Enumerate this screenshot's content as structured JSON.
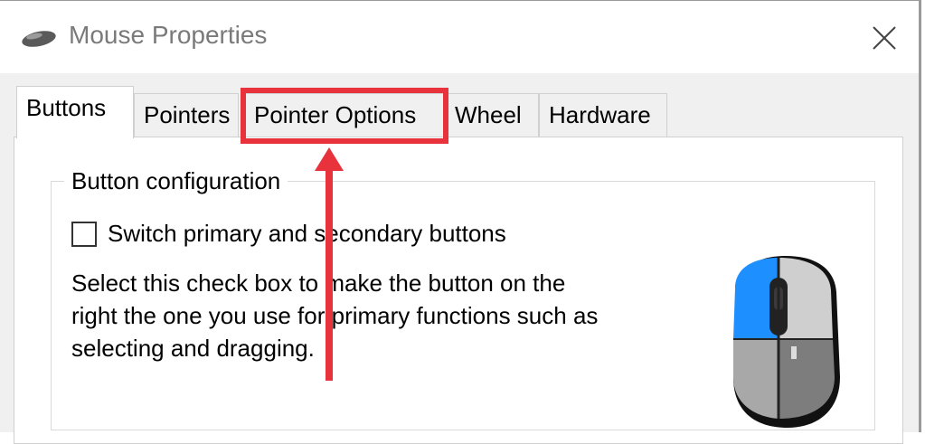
{
  "window": {
    "title": "Mouse Properties",
    "close_icon": "close-icon",
    "app_icon": "mouse-icon"
  },
  "tabs": [
    {
      "label": "Buttons",
      "active": true
    },
    {
      "label": "Pointers",
      "active": false
    },
    {
      "label": "Pointer Options",
      "active": false,
      "highlighted": true
    },
    {
      "label": "Wheel",
      "active": false
    },
    {
      "label": "Hardware",
      "active": false
    }
  ],
  "button_configuration": {
    "group_title": "Button configuration",
    "checkbox_label": "Switch primary and secondary buttons",
    "checkbox_checked": false,
    "description": "Select this check box to make the button on the right the one you use for primary functions such as selecting and dragging."
  },
  "colors": {
    "annotation_red": "#e8323c",
    "mouse_accent_blue": "#1e8fff"
  }
}
